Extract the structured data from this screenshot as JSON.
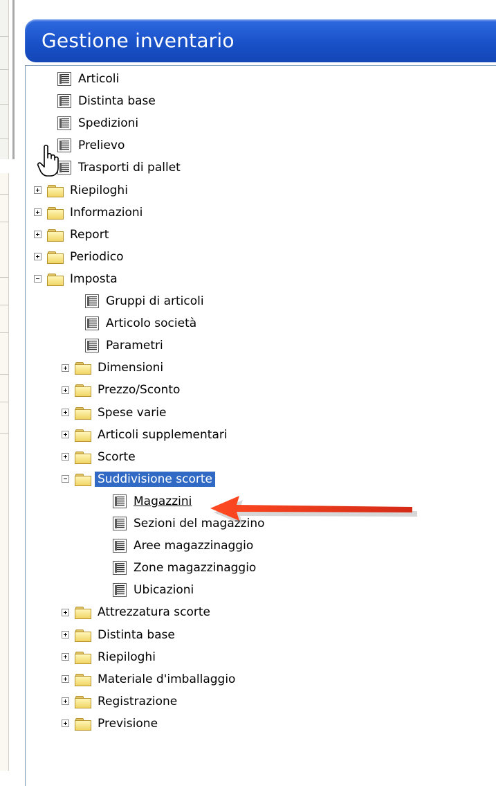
{
  "window": {
    "title": "Gestione inventario"
  },
  "tree": [
    {
      "label": "Articoli",
      "type": "doc",
      "level": 1
    },
    {
      "label": "Distinta base",
      "type": "doc",
      "level": 1
    },
    {
      "label": "Spedizioni",
      "type": "doc",
      "level": 1
    },
    {
      "label": "Prelievo",
      "type": "doc",
      "level": 1
    },
    {
      "label": "Trasporti di pallet",
      "type": "doc",
      "level": 1
    },
    {
      "label": "Riepiloghi",
      "type": "folder",
      "level": 0,
      "expander": "plus"
    },
    {
      "label": "Informazioni",
      "type": "folder",
      "level": 0,
      "expander": "plus"
    },
    {
      "label": "Report",
      "type": "folder",
      "level": 0,
      "expander": "plus"
    },
    {
      "label": "Periodico",
      "type": "folder",
      "level": 0,
      "expander": "plus"
    },
    {
      "label": "Imposta",
      "type": "folder",
      "level": 0,
      "expander": "minus"
    },
    {
      "label": "Gruppi di articoli",
      "type": "doc",
      "level": 2
    },
    {
      "label": "Articolo società",
      "type": "doc",
      "level": 2
    },
    {
      "label": "Parametri",
      "type": "doc",
      "level": 2
    },
    {
      "label": "Dimensioni",
      "type": "folder",
      "level": 1,
      "expander": "plus"
    },
    {
      "label": "Prezzo/Sconto",
      "type": "folder",
      "level": 1,
      "expander": "plus"
    },
    {
      "label": "Spese varie",
      "type": "folder",
      "level": 1,
      "expander": "plus"
    },
    {
      "label": "Articoli supplementari",
      "type": "folder",
      "level": 1,
      "expander": "plus"
    },
    {
      "label": "Scorte",
      "type": "folder",
      "level": 1,
      "expander": "plus"
    },
    {
      "label": "Suddivisione scorte",
      "type": "folder",
      "level": 1,
      "expander": "minus",
      "selected": true
    },
    {
      "label": "Magazzini",
      "type": "doc",
      "level": 3,
      "underlined": true
    },
    {
      "label": "Sezioni del magazzino",
      "type": "doc",
      "level": 3
    },
    {
      "label": "Aree magazzinaggio",
      "type": "doc",
      "level": 3
    },
    {
      "label": "Zone magazzinaggio",
      "type": "doc",
      "level": 3
    },
    {
      "label": "Ubicazioni",
      "type": "doc",
      "level": 3
    },
    {
      "label": "Attrezzatura scorte",
      "type": "folder",
      "level": 1,
      "expander": "plus"
    },
    {
      "label": "Distinta base",
      "type": "folder",
      "level": 1,
      "expander": "plus"
    },
    {
      "label": "Riepiloghi",
      "type": "folder",
      "level": 1,
      "expander": "plus"
    },
    {
      "label": "Materiale d'imballaggio",
      "type": "folder",
      "level": 1,
      "expander": "plus"
    },
    {
      "label": "Registrazione",
      "type": "folder",
      "level": 1,
      "expander": "plus"
    },
    {
      "label": "Previsione",
      "type": "folder",
      "level": 1,
      "expander": "plus"
    }
  ],
  "colors": {
    "title_bar": "#1951c9",
    "selection": "#316ac5",
    "annotation_arrow": "#e8321c"
  },
  "icons": {
    "doc": "document-list-icon",
    "folder": "folder-icon",
    "cursor": "hand-pointer-icon",
    "annotation": "red-arrow-icon"
  }
}
